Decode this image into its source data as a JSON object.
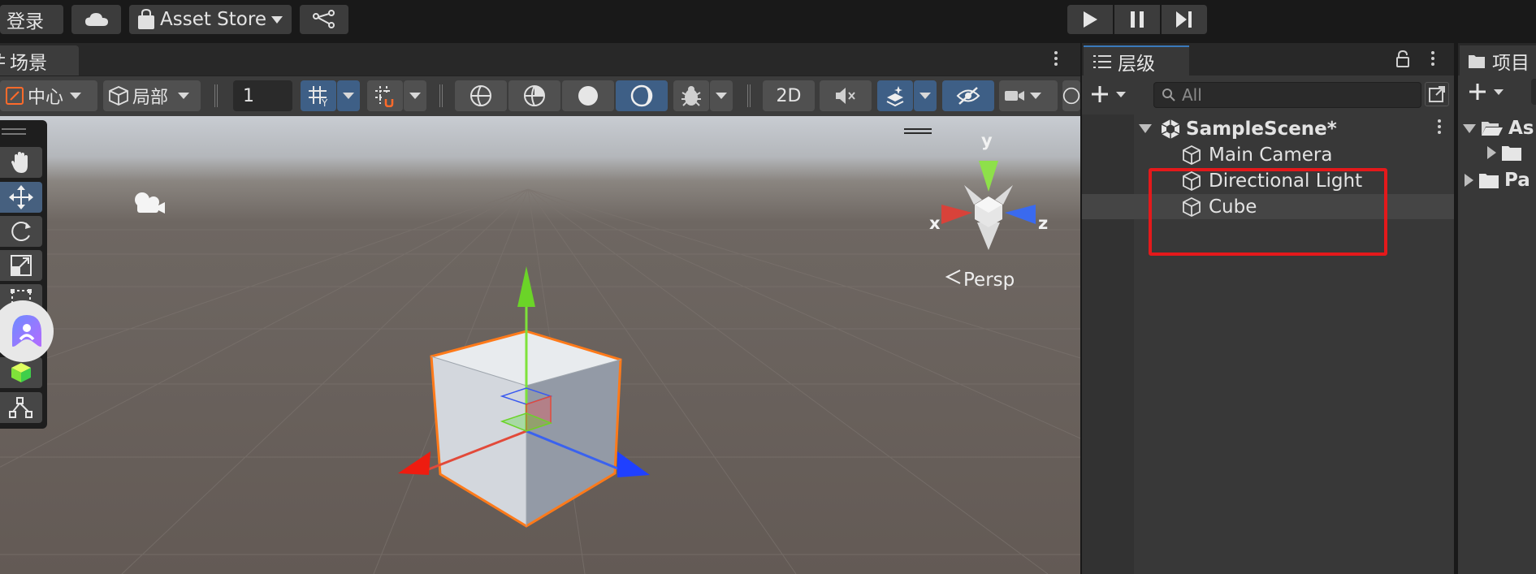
{
  "toolbar": {
    "login_label": "登录",
    "asset_store_label": "Asset Store",
    "play_icon": "play-icon",
    "pause_icon": "pause-icon",
    "step_icon": "step-icon"
  },
  "scene": {
    "tab_label": "场景",
    "pivot_label": "中心",
    "space_label": "局部",
    "grid_value": "1",
    "mode_2d_label": "2D",
    "persp_label": "Persp",
    "axis_x": "x",
    "axis_y": "y",
    "axis_z": "z"
  },
  "hierarchy": {
    "tab_label": "层级",
    "search_placeholder": "All",
    "scene_name": "SampleScene*",
    "items": [
      {
        "label": "Main Camera"
      },
      {
        "label": "Directional Light"
      },
      {
        "label": "Cube"
      }
    ]
  },
  "project": {
    "tab_label": "项目",
    "folders": [
      {
        "label": "As"
      },
      {
        "label": "Pa"
      }
    ]
  },
  "colors": {
    "accent": "#3a79bb",
    "selection_outline": "#ff7a1a",
    "highlight_box": "#e4191b"
  }
}
